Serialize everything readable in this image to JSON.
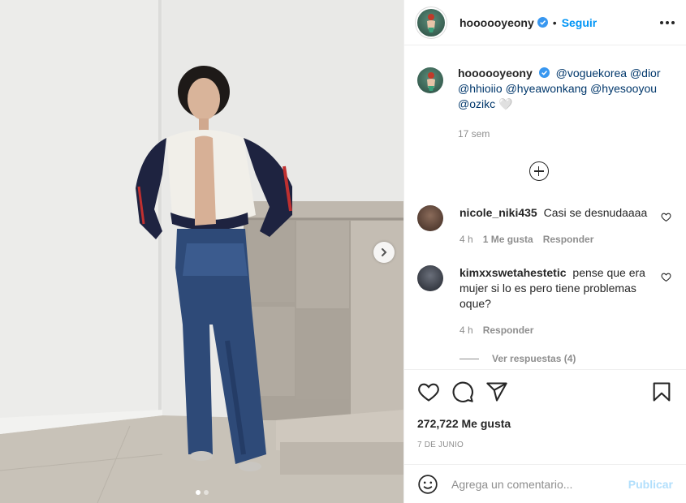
{
  "post": {
    "username": "hoooooyeony",
    "follow_label": "Seguir",
    "separator": "•",
    "caption": {
      "username": "hoooooyeony",
      "mentions": [
        "@voguekorea",
        "@dior",
        "@hhioiio",
        "@hyeawonkang",
        "@hyesooyou",
        "@ozikc"
      ],
      "trailing": "🤍",
      "time": "17 sem"
    },
    "comments": [
      {
        "username": "nicole_niki435",
        "text": "Casi se desnudaaaa",
        "time": "4 h",
        "likes": "1 Me gusta",
        "reply": "Responder"
      },
      {
        "username": "kimxxswetahestetic",
        "text": "pense que era mujer si lo es pero tiene problemas oque?",
        "time": "4 h",
        "reply": "Responder"
      }
    ],
    "view_replies": "Ver respuestas (4)",
    "likes_count": "272,722 Me gusta",
    "date": "7 DE JUNIO",
    "comment_placeholder": "Agrega un comentario...",
    "publish_label": "Publicar"
  },
  "icons": {
    "verified": "verified-badge-icon",
    "more": "more-options-icon",
    "like": "heart-icon",
    "comment": "comment-bubble-icon",
    "share": "paper-plane-icon",
    "save": "bookmark-icon",
    "emoji": "emoji-icon",
    "next": "chevron-right-icon",
    "load_more": "plus-circle-icon"
  },
  "colors": {
    "accent": "#0095f6",
    "publish_disabled": "#b2dffc",
    "verified": "#3897f0"
  },
  "carousel": {
    "current": 1,
    "total": 2
  }
}
